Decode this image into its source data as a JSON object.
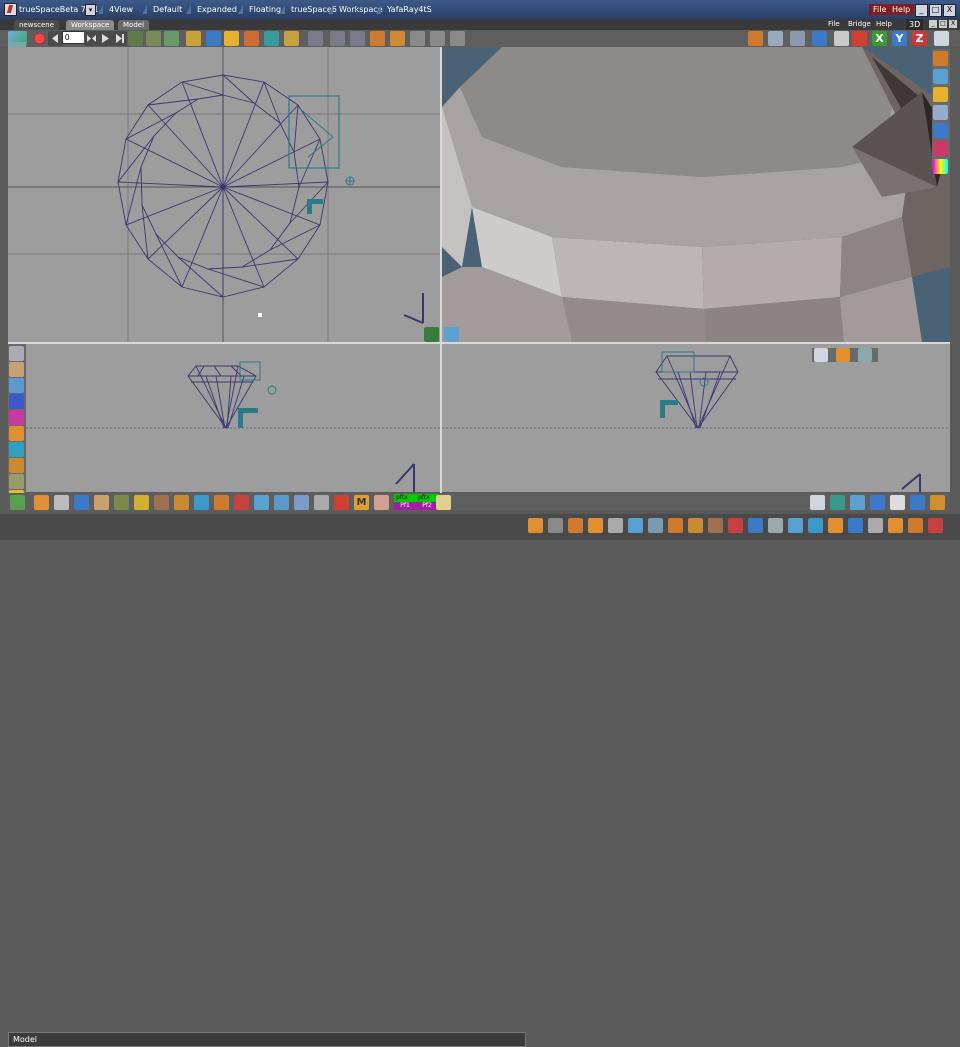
{
  "app": {
    "title": "trueSpaceBeta 7.61",
    "layout_tabs": [
      "4View",
      "Default",
      "Expanded",
      "Floating",
      "trueSpace6",
      "Workspace",
      "YafaRay4tS"
    ],
    "top_menu": [
      "File",
      "Help"
    ],
    "window_controls": [
      "_",
      "□",
      "X"
    ]
  },
  "workspace_bar": {
    "scene_name": "newscene",
    "tabs": [
      "Workspace",
      "Model"
    ],
    "active_tab": "Workspace",
    "menu": [
      "File",
      "Bridge",
      "Help"
    ],
    "mode_badge": "3D",
    "window_controls": [
      "_",
      "□",
      "X"
    ]
  },
  "toolbar": {
    "frame_value": "0"
  },
  "bottom_buttons": {
    "pfx_labels": [
      "pftx",
      "pftx"
    ],
    "pfx_sub": [
      "Pf1",
      "Pf2"
    ]
  },
  "status": {
    "mode": "Model"
  },
  "colors": {
    "title_bar": "#2f4a78",
    "viewport_bg": "#9d9d9d",
    "perspective_bg": "#4a6276",
    "wireframe": "#3a3770",
    "gizmo": "#2a7a8a",
    "model_shade": "#9b8f8c",
    "menu_red": "#7c1f1f"
  }
}
